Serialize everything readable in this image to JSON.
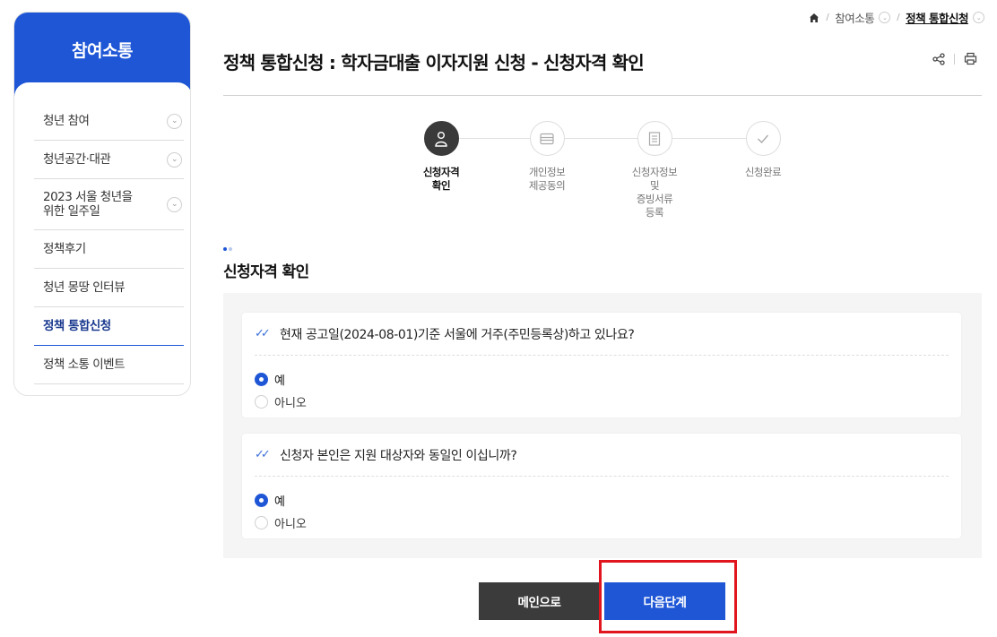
{
  "sidebar": {
    "title": "참여소통",
    "items": [
      {
        "label": "청년 참여",
        "has_chevron": true
      },
      {
        "label": "청년공간·대관",
        "has_chevron": true
      },
      {
        "label": "2023 서울 청년을\n위한 일주일",
        "has_chevron": true
      },
      {
        "label": "정책후기",
        "has_chevron": false
      },
      {
        "label": "청년 몽땅 인터뷰",
        "has_chevron": false
      },
      {
        "label": "정책 통합신청",
        "has_chevron": false,
        "active": true
      },
      {
        "label": "정책 소통 이벤트",
        "has_chevron": false
      }
    ]
  },
  "breadcrumb": {
    "icon": "home-icon",
    "items": [
      "참여소통",
      "정책 통합신청"
    ]
  },
  "page": {
    "title": "정책 통합신청 : 학자금대출 이자지원 신청 - 신청자격 확인",
    "tools": [
      "share-icon",
      "print-icon"
    ]
  },
  "steps": [
    {
      "label": "신청자격\n확인",
      "icon": "person-icon",
      "active": true
    },
    {
      "label": "개인정보\n제공동의",
      "icon": "card-icon",
      "active": false
    },
    {
      "label": "신청자정보\n및\n증빙서류\n등록",
      "icon": "document-icon",
      "active": false
    },
    {
      "label": "신청완료",
      "icon": "check-icon",
      "active": false
    }
  ],
  "section": {
    "title": "신청자격 확인"
  },
  "questions": [
    {
      "text": "현재 공고일(2024-08-01)기준 서울에 거주(주민등록상)하고 있나요?",
      "options": [
        {
          "label": "예",
          "selected": true
        },
        {
          "label": "아니오",
          "selected": false
        }
      ]
    },
    {
      "text": "신청자 본인은 지원 대상자와 동일인 이십니까?",
      "options": [
        {
          "label": "예",
          "selected": true
        },
        {
          "label": "아니오",
          "selected": false
        }
      ]
    }
  ],
  "buttons": {
    "main": "메인으로",
    "next": "다음단계"
  },
  "colors": {
    "brand": "#1e56d6",
    "dark_button": "#3b3b3b",
    "highlight": "#e0151d",
    "panel_bg": "#f5f5f5"
  }
}
